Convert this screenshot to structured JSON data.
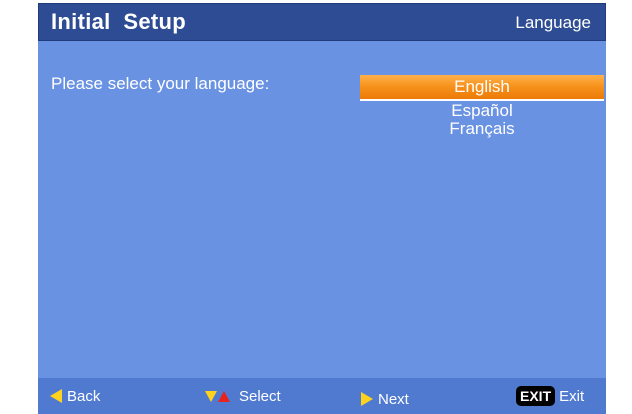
{
  "header": {
    "title": "Initial  Setup",
    "section": "Language"
  },
  "main": {
    "prompt": "Please select your language:",
    "languages": [
      {
        "label": "English",
        "selected": true
      },
      {
        "label": "Español",
        "selected": false
      },
      {
        "label": "Français",
        "selected": false
      }
    ]
  },
  "footer": {
    "back_label": "Back",
    "back_icon": "arrow-left-icon",
    "select_label": "Select",
    "select_icon": "up-down-arrows-icon",
    "next_label": "Next",
    "next_icon": "arrow-right-icon",
    "exit_badge": "EXIT",
    "exit_label": "Exit"
  },
  "colors": {
    "header_bg": "#2d4c93",
    "content_bg": "#6a92e2",
    "footer_bg": "#4f7ad0",
    "highlight": "#f7931e",
    "arrow_yellow": "#ffd21e",
    "arrow_red": "#e8231e"
  }
}
